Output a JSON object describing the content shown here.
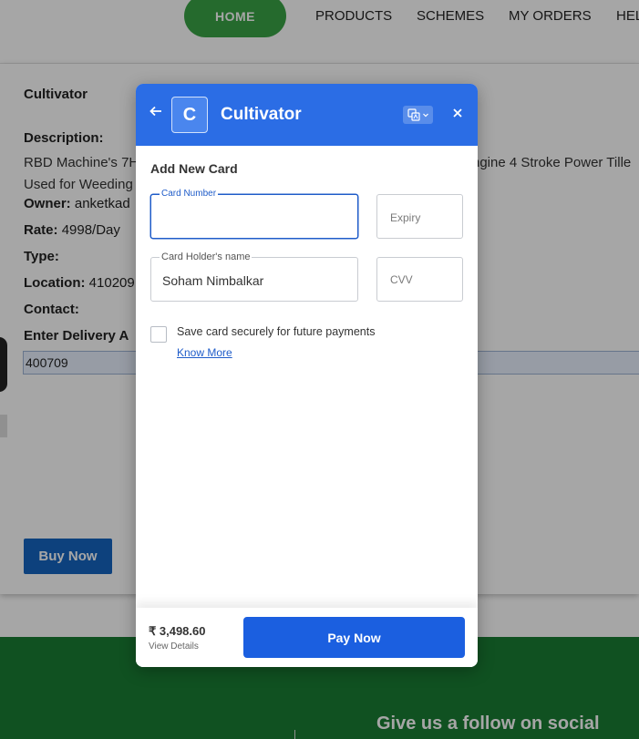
{
  "nav": {
    "items": [
      "HOME",
      "PRODUCTS",
      "SCHEMES",
      "MY ORDERS",
      "HEL"
    ]
  },
  "product": {
    "title": "Cultivator",
    "description_label": "Description:",
    "description_line1": "RBD Machine's 7H",
    "description_line1_tail": "ngine 4 Stroke Power Tille",
    "description_line2": "Used for Weeding",
    "owner_label": "Owner:",
    "owner_value": "anketkad",
    "rate_label": "Rate:",
    "rate_value": "4998/Day",
    "type_label": "Type:",
    "location_label": "Location:",
    "location_value": "410209",
    "contact_label": "Contact:",
    "delivery_label": "Enter Delivery A",
    "delivery_value": "400709",
    "buy_label": "Buy Now"
  },
  "footer": {
    "social_text": "Give us a follow on social"
  },
  "modal": {
    "back_icon": "←",
    "logo_letter": "C",
    "title": "Cultivator",
    "lang_icon": "translate-icon",
    "close_icon": "×",
    "section_title": "Add New Card",
    "card_number_label": "Card Number",
    "card_number_value": "",
    "expiry_placeholder": "Expiry",
    "holder_label": "Card Holder's name",
    "holder_value": "Soham Nimbalkar",
    "cvv_placeholder": "CVV",
    "save_card_label": "Save card securely for future payments",
    "know_more": "Know More",
    "amount": "₹ 3,498.60",
    "view_details": "View Details",
    "pay_label": "Pay Now"
  },
  "colors": {
    "header_blue": "#2b6de5",
    "pay_blue": "#1b5fe0",
    "nav_green": "#3aa346",
    "footer_green": "#1a7d33"
  }
}
